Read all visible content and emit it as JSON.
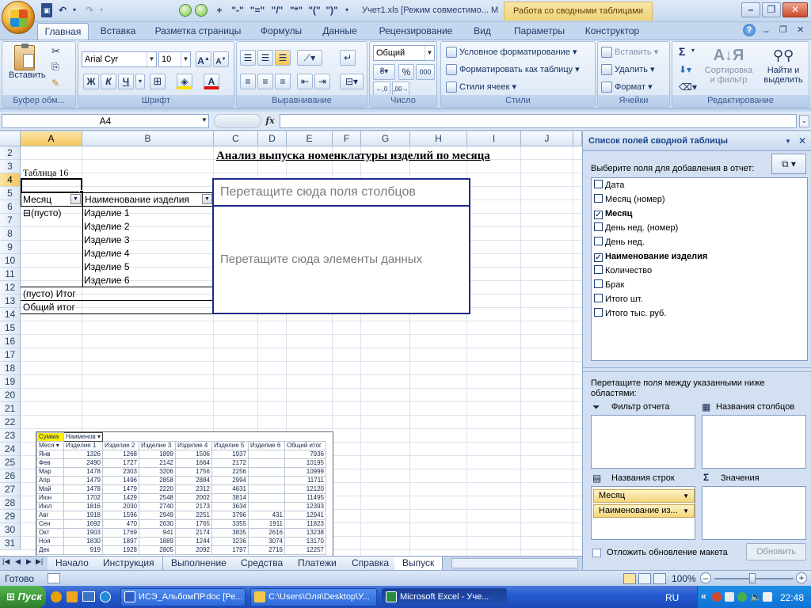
{
  "window": {
    "title": "Учет1.xls  [Режим совместимо... M",
    "context_tab": "Работа со сводными таблицами"
  },
  "qat": {
    "items": [
      "+",
      "\"-\"",
      "\"=\"",
      "\"/\"",
      "\"*\"",
      "\"(\"",
      "\")\""
    ]
  },
  "tabs": [
    "Главная",
    "Вставка",
    "Разметка страницы",
    "Формулы",
    "Данные",
    "Рецензирование",
    "Вид",
    "Параметры",
    "Конструктор"
  ],
  "ribbon": {
    "paste_label": "Вставить",
    "font_name": "Arial Cyr",
    "font_size": "10",
    "bold": "Ж",
    "italic": "К",
    "underline": "Ч",
    "number_format": "Общий",
    "percent": "%",
    "thousands": "000",
    "cond_format": "Условное форматирование",
    "format_table": "Форматировать как таблицу",
    "cell_styles": "Стили ячеек",
    "insert": "Вставить",
    "delete": "Удалить",
    "format": "Формат",
    "sigma": "Σ",
    "sort_filter": [
      "Сортировка",
      "и фильтр"
    ],
    "find_select": [
      "Найти и",
      "выделить"
    ],
    "groups": [
      "Буфер обм...",
      "Шрифт",
      "Выравнивание",
      "Число",
      "Стили",
      "Ячейки",
      "Редактирование"
    ]
  },
  "formula_bar": {
    "name_box": "A4",
    "fx": "fx",
    "value": ""
  },
  "grid": {
    "columns": [
      "A",
      "B",
      "C",
      "D",
      "E",
      "F",
      "G",
      "H",
      "I",
      "J"
    ],
    "rows": [
      "2",
      "3",
      "4",
      "5",
      "6",
      "7",
      "8",
      "9",
      "10",
      "11",
      "12",
      "13",
      "14",
      "15",
      "16",
      "17",
      "18",
      "19",
      "20",
      "21",
      "22",
      "23",
      "24",
      "25",
      "26",
      "27",
      "28",
      "29",
      "30",
      "31"
    ],
    "title": "Анализ выпуска номенклатуры изделий по месяца",
    "table_label": "Таблица 16",
    "pivot": {
      "row_field_1": "Месяц",
      "row_field_2": "Наименование изделия",
      "empty_item": "⊟(пусто)",
      "items": [
        "Изделие 1",
        "Изделие 2",
        "Изделие 3",
        "Изделие 4",
        "Изделие 5",
        "Изделие 6"
      ],
      "subtotal": "(пусто) Итог",
      "grand_total": "Общий итог",
      "drop_columns": "Перетащите сюда поля столбцов",
      "drop_data": "Перетащите сюда элементы данных"
    }
  },
  "embedded_pivot": {
    "h1": [
      "Сумма",
      "Наименов ▾"
    ],
    "header": [
      "Меся ▾",
      "Изделие 1",
      "Изделие 2",
      "Изделие 3",
      "Изделие 4",
      "Изделие 5",
      "Изделие 6",
      "Общий итог"
    ],
    "rows": [
      [
        "Янв",
        "1326",
        "1268",
        "1899",
        "1506",
        "1937",
        "",
        "7936"
      ],
      [
        "Фев",
        "2490",
        "1727",
        "2142",
        "1664",
        "2172",
        "",
        "10195"
      ],
      [
        "Мар",
        "1478",
        "2303",
        "3206",
        "1756",
        "2256",
        "",
        "10999"
      ],
      [
        "Апр",
        "1479",
        "1496",
        "2858",
        "2884",
        "2994",
        "",
        "11711"
      ],
      [
        "Май",
        "1478",
        "1479",
        "2220",
        "2312",
        "4631",
        "",
        "12120"
      ],
      [
        "Июн",
        "1702",
        "1429",
        "2548",
        "2002",
        "3814",
        "",
        "11495"
      ],
      [
        "Июл",
        "1816",
        "2030",
        "2740",
        "2173",
        "3634",
        "",
        "12393"
      ],
      [
        "Авг",
        "1918",
        "1596",
        "2949",
        "2251",
        "3796",
        "431",
        "12941"
      ],
      [
        "Сен",
        "1692",
        "470",
        "2630",
        "1765",
        "3355",
        "1911",
        "11823"
      ],
      [
        "Окт",
        "1903",
        "1769",
        "941",
        "2174",
        "3835",
        "2616",
        "13238"
      ],
      [
        "Ноя",
        "1830",
        "1897",
        "1889",
        "1244",
        "3236",
        "3074",
        "13170"
      ],
      [
        "Дек",
        "919",
        "1928",
        "2805",
        "2092",
        "1797",
        "2716",
        "12257"
      ]
    ]
  },
  "sheet_tabs": [
    "Начало",
    "Инструкция",
    "Выполнение",
    "Средства",
    "Платежи",
    "Справка",
    "Выпуск"
  ],
  "status": {
    "ready": "Готово",
    "zoom": "100%"
  },
  "taskpane": {
    "title": "Список полей сводной таблицы",
    "choose": "Выберите поля для добавления в отчет:",
    "fields": [
      {
        "label": "Дата",
        "checked": false
      },
      {
        "label": "Месяц (номер)",
        "checked": false
      },
      {
        "label": "Месяц",
        "checked": true
      },
      {
        "label": "День нед. (номер)",
        "checked": false
      },
      {
        "label": "День нед.",
        "checked": false
      },
      {
        "label": "Наименование изделия",
        "checked": true
      },
      {
        "label": "Количество",
        "checked": false
      },
      {
        "label": "Брак",
        "checked": false
      },
      {
        "label": "Итого шт.",
        "checked": false
      },
      {
        "label": "Итого тыс. руб.",
        "checked": false
      }
    ],
    "drag_hint": "Перетащите поля между указанными ниже областями:",
    "filter_label": "Фильтр отчета",
    "columns_label": "Названия столбцов",
    "rows_label": "Названия строк",
    "values_label": "Значения",
    "row_chips": [
      "Месяц",
      "Наименование из..."
    ],
    "defer": "Отложить обновление макета",
    "update": "Обновить"
  },
  "taskbar": {
    "start": "Пуск",
    "buttons": [
      "ИСЭ_АльбомПР.doc [Ре...",
      "C:\\Users\\Оля\\Desktop\\У...",
      "Microsoft Excel - Уче..."
    ],
    "lang": "RU",
    "time": "22:48"
  }
}
